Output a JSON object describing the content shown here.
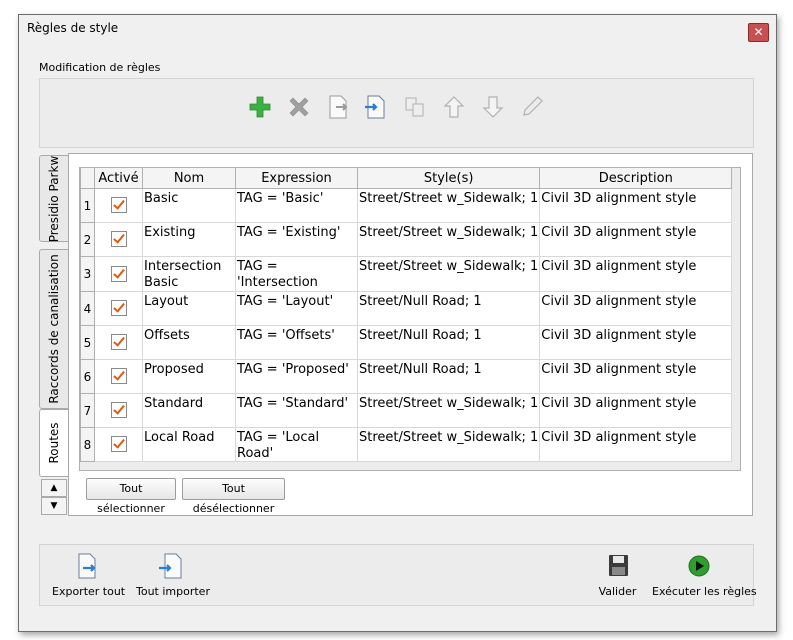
{
  "window": {
    "title": "Règles de style",
    "close_label": "✕"
  },
  "rules_group": {
    "label": "Modification de règles"
  },
  "toolbar_icons": [
    "add-icon",
    "delete-icon",
    "export-rule-icon",
    "import-rule-icon",
    "copy-icon",
    "move-up-icon",
    "move-down-icon",
    "edit-icon"
  ],
  "tabs": [
    {
      "label": "Presidio Parkw"
    },
    {
      "label": "Raccords de canalisation"
    },
    {
      "label": "Routes"
    }
  ],
  "grid": {
    "headers": [
      "Activé",
      "Nom",
      "Expression",
      "Style(s)",
      "Description"
    ],
    "rows": [
      {
        "num": "1",
        "checked": true,
        "nom": "Basic",
        "expression": "TAG = 'Basic'",
        "style": "Street/Street w_Sidewalk; 1",
        "description": "Civil 3D alignment style"
      },
      {
        "num": "2",
        "checked": true,
        "nom": "Existing",
        "expression": "TAG = 'Existing'",
        "style": "Street/Street w_Sidewalk; 1",
        "description": "Civil 3D alignment style"
      },
      {
        "num": "3",
        "checked": true,
        "nom": "Intersection Basic",
        "expression": "TAG = 'Intersection Basic'",
        "style": "Street/Street w_Sidewalk; 1",
        "description": "Civil 3D alignment style"
      },
      {
        "num": "4",
        "checked": true,
        "nom": "Layout",
        "expression": "TAG = 'Layout'",
        "style": "Street/Null Road; 1",
        "description": "Civil 3D alignment style"
      },
      {
        "num": "5",
        "checked": true,
        "nom": "Offsets",
        "expression": "TAG = 'Offsets'",
        "style": "Street/Null Road; 1",
        "description": "Civil 3D alignment style"
      },
      {
        "num": "6",
        "checked": true,
        "nom": "Proposed",
        "expression": "TAG = 'Proposed'",
        "style": "Street/Null Road; 1",
        "description": "Civil 3D alignment style"
      },
      {
        "num": "7",
        "checked": true,
        "nom": "Standard",
        "expression": "TAG = 'Standard'",
        "style": "Street/Street w_Sidewalk; 1",
        "description": "Civil 3D alignment style"
      },
      {
        "num": "8",
        "checked": true,
        "nom": "Local Road",
        "expression": "TAG = 'Local Road'",
        "style": "Street/Street w_Sidewalk; 1",
        "description": "Civil 3D alignment style"
      }
    ]
  },
  "buttons": {
    "select_all": "Tout sélectionner",
    "deselect_all": "Tout désélectionner",
    "scroll_up": "▲",
    "scroll_down": "▼",
    "export_all": "Exporter tout",
    "import_all": "Tout importer",
    "validate": "Valider",
    "run_rules": "Exécuter les règles"
  },
  "colors": {
    "add": "#3cb043",
    "delete": "#9a9a9a",
    "check": "#e05a10",
    "run": "#2e9e2e",
    "arrow": "#2a7fd4"
  }
}
